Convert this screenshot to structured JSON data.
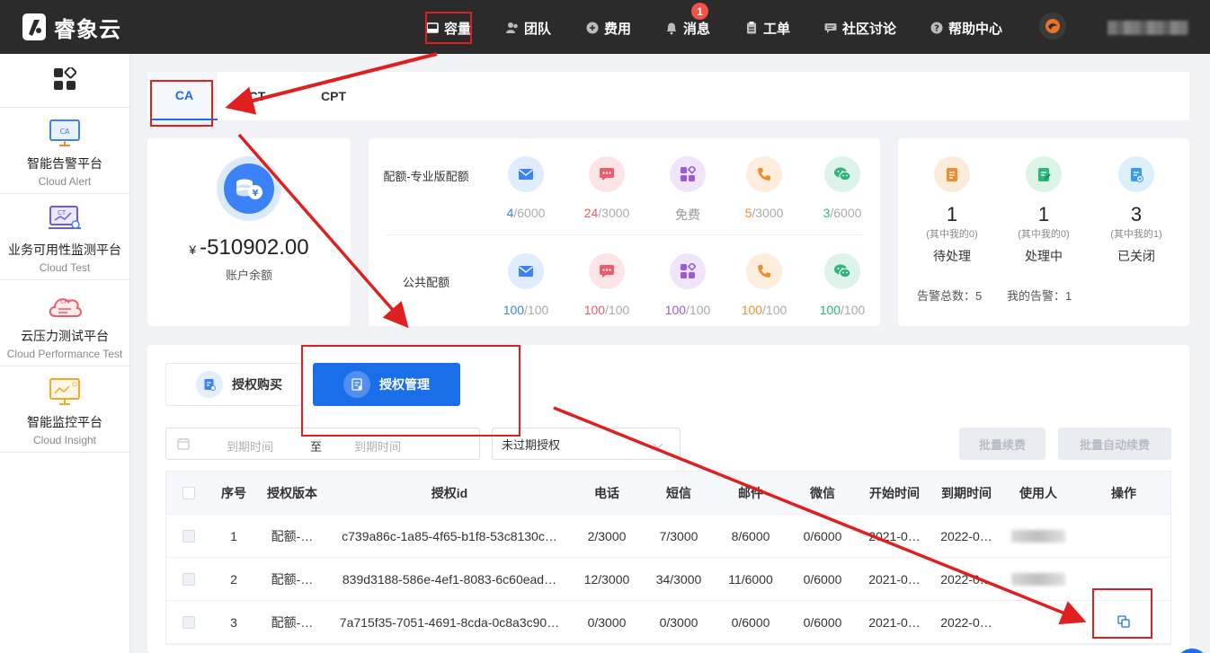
{
  "header": {
    "logo_text": "睿象云",
    "nav": [
      {
        "label": "容量",
        "icon": "box-icon"
      },
      {
        "label": "团队",
        "icon": "team-icon"
      },
      {
        "label": "费用",
        "icon": "coin-icon"
      },
      {
        "label": "消息",
        "icon": "bell-icon",
        "badge": "1"
      },
      {
        "label": "工单",
        "icon": "clipboard-icon"
      },
      {
        "label": "社区讨论",
        "icon": "chat-icon"
      },
      {
        "label": "帮助中心",
        "icon": "help-icon"
      }
    ]
  },
  "sidebar": {
    "items": [
      {
        "title": "智能告警平台",
        "subtitle": "Cloud Alert",
        "icon": "cloud-alert-icon"
      },
      {
        "title": "业务可用性监测平台",
        "subtitle": "Cloud Test",
        "icon": "cloud-test-icon"
      },
      {
        "title": "云压力测试平台",
        "subtitle": "Cloud Performance Test",
        "icon": "cloud-performance-icon"
      },
      {
        "title": "智能监控平台",
        "subtitle": "Cloud Insight",
        "icon": "cloud-insight-icon"
      }
    ]
  },
  "tabs": [
    "CA",
    "CT",
    "CPT"
  ],
  "balance": {
    "currency": "¥",
    "amount": "-510902.00",
    "label": "账户余额"
  },
  "quota": {
    "pro_title": "配额-专业版配额",
    "pro": [
      {
        "used": "4",
        "total": "/6000",
        "color": "#3b82f6",
        "icon": "mail-icon"
      },
      {
        "used": "24",
        "total": "/3000",
        "color": "#f05a6a",
        "icon": "sms-icon"
      },
      {
        "used": "免费",
        "total": "",
        "color": "#999999",
        "icon": "apps-icon"
      },
      {
        "used": "5",
        "total": "/3000",
        "color": "#f08c2e",
        "icon": "phone-icon"
      },
      {
        "used": "3",
        "total": "/6000",
        "color": "#2db67c",
        "icon": "wechat-icon"
      }
    ],
    "public_title": "公共配额",
    "public": [
      {
        "used": "100",
        "total": "/100",
        "color": "#3b82f6",
        "icon": "mail-icon"
      },
      {
        "used": "100",
        "total": "/100",
        "color": "#f05a6a",
        "icon": "sms-icon"
      },
      {
        "used": "100",
        "total": "/100",
        "color": "#9a5ae0",
        "icon": "apps-icon"
      },
      {
        "used": "100",
        "total": "/100",
        "color": "#f08c2e",
        "icon": "phone-icon"
      },
      {
        "used": "100",
        "total": "/100",
        "color": "#2db67c",
        "icon": "wechat-icon"
      }
    ]
  },
  "tickets": {
    "items": [
      {
        "count": "1",
        "mine": "(其中我的0)",
        "label": "待处理"
      },
      {
        "count": "1",
        "mine": "(其中我的0)",
        "label": "处理中"
      },
      {
        "count": "3",
        "mine": "(其中我的1)",
        "label": "已关闭"
      }
    ],
    "total": "告警总数：5",
    "my": "我的告警：1"
  },
  "license": {
    "buy_label": "授权购买",
    "manage_label": "授权管理",
    "date_start_placeholder": "到期时间",
    "date_sep": "至",
    "date_end_placeholder": "到期时间",
    "filter_value": "未过期授权",
    "batch_renew": "批量续费",
    "batch_auto_renew": "批量自动续费",
    "columns": [
      "序号",
      "授权版本",
      "授权id",
      "电话",
      "短信",
      "邮件",
      "微信",
      "开始时间",
      "到期时间",
      "使用人",
      "操作"
    ],
    "rows": [
      {
        "no": "1",
        "version": "配额-…",
        "id": "c739a86c-1a85-4f65-b1f8-53c8130c…",
        "phone": "2/3000",
        "sms": "7/3000",
        "mail": "8/6000",
        "wechat": "0/6000",
        "start": "2021-0…",
        "end": "2022-0…"
      },
      {
        "no": "2",
        "version": "配额-…",
        "id": "839d3188-586e-4ef1-8083-6c60ead…",
        "phone": "12/3000",
        "sms": "34/3000",
        "mail": "11/6000",
        "wechat": "0/6000",
        "start": "2021-0…",
        "end": "2022-0…"
      },
      {
        "no": "3",
        "version": "配额-…",
        "id": "7a715f35-7051-4691-8cda-0c8a3c90…",
        "phone": "0/3000",
        "sms": "0/3000",
        "mail": "0/6000",
        "wechat": "0/6000",
        "start": "2021-0…",
        "end": "2022-0…"
      }
    ]
  },
  "colors": {
    "accent": "#1a6fe8",
    "header_bg": "#2b2b2b",
    "annotation": "#e02020"
  }
}
